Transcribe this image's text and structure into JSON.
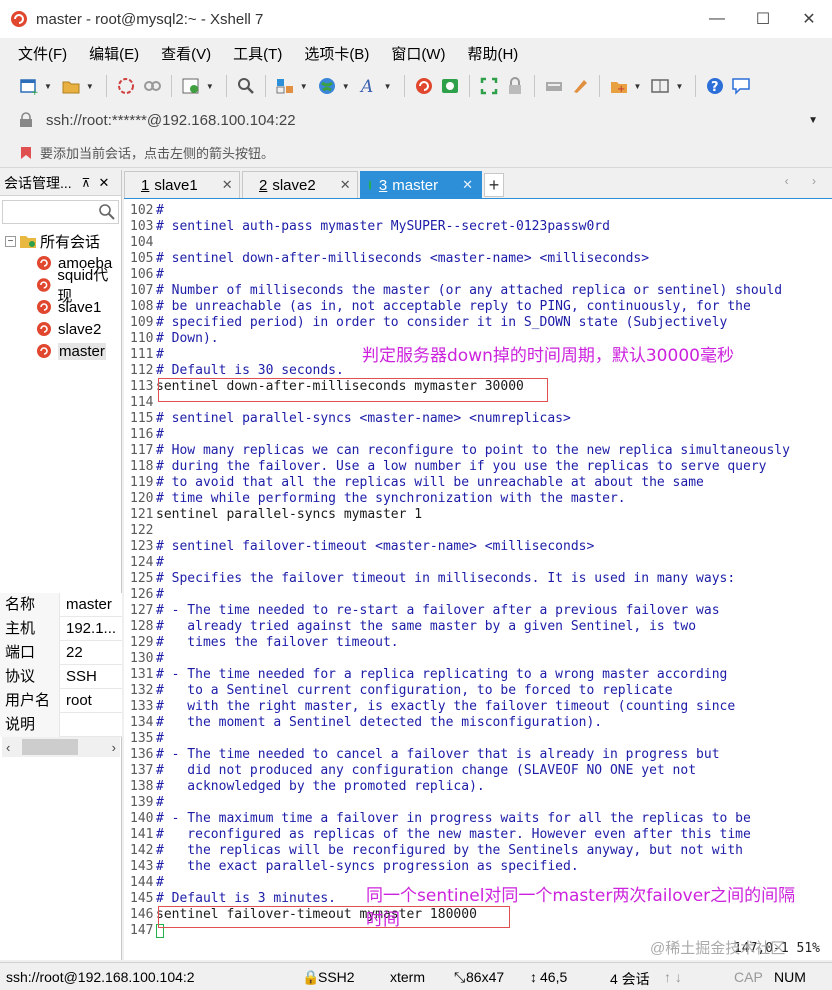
{
  "window": {
    "title": "master - root@mysql2:~ - Xshell 7",
    "minimize": "—",
    "maximize": "☐",
    "close": "✕"
  },
  "menu": [
    "文件(F)",
    "编辑(E)",
    "查看(V)",
    "工具(T)",
    "选项卡(B)",
    "窗口(W)",
    "帮助(H)"
  ],
  "address": {
    "value": "ssh://root:******@192.168.100.104:22"
  },
  "hint": "要添加当前会话，点击左侧的箭头按钮。",
  "sidebar": {
    "title": "会话管理...",
    "pin": "⊼",
    "close": "✕",
    "root_label": "所有会话",
    "expander": "−",
    "items": [
      {
        "label": "amoeba"
      },
      {
        "label": "squid代现"
      },
      {
        "label": "slave1"
      },
      {
        "label": "slave2"
      },
      {
        "label": "master"
      }
    ],
    "scroll_left": "‹",
    "scroll_right": "›"
  },
  "properties": [
    {
      "key": "名称",
      "value": "master"
    },
    {
      "key": "主机",
      "value": "192.1..."
    },
    {
      "key": "端口",
      "value": "22"
    },
    {
      "key": "协议",
      "value": "SSH"
    },
    {
      "key": "用户名",
      "value": "root"
    },
    {
      "key": "说明",
      "value": ""
    }
  ],
  "tabs": [
    {
      "num": "1",
      "label": "slave1",
      "close": "✕"
    },
    {
      "num": "2",
      "label": "slave2",
      "close": "✕"
    },
    {
      "num": "3",
      "label": "master",
      "close": "✕"
    }
  ],
  "tab_add": "+",
  "tab_nav": "‹ ›",
  "terminal": {
    "lines": [
      {
        "n": "102",
        "t": "#",
        "plain": false
      },
      {
        "n": "103",
        "t": "# sentinel auth-pass mymaster MySUPER--secret-0123passw0rd",
        "plain": false
      },
      {
        "n": "104",
        "t": "",
        "plain": false
      },
      {
        "n": "105",
        "t": "# sentinel down-after-milliseconds <master-name> <milliseconds>",
        "plain": false
      },
      {
        "n": "106",
        "t": "#",
        "plain": false
      },
      {
        "n": "107",
        "t": "# Number of milliseconds the master (or any attached replica or sentinel) should",
        "plain": false
      },
      {
        "n": "108",
        "t": "# be unreachable (as in, not acceptable reply to PING, continuously, for the",
        "plain": false
      },
      {
        "n": "109",
        "t": "# specified period) in order to consider it in S_DOWN state (Subjectively",
        "plain": false
      },
      {
        "n": "110",
        "t": "# Down).",
        "plain": false
      },
      {
        "n": "111",
        "t": "#",
        "plain": false
      },
      {
        "n": "112",
        "t": "# Default is 30 seconds.",
        "plain": false
      },
      {
        "n": "113",
        "t": "sentinel down-after-milliseconds mymaster 30000",
        "plain": true
      },
      {
        "n": "114",
        "t": "",
        "plain": false
      },
      {
        "n": "115",
        "t": "# sentinel parallel-syncs <master-name> <numreplicas>",
        "plain": false
      },
      {
        "n": "116",
        "t": "#",
        "plain": false
      },
      {
        "n": "117",
        "t": "# How many replicas we can reconfigure to point to the new replica simultaneously",
        "plain": false
      },
      {
        "n": "118",
        "t": "# during the failover. Use a low number if you use the replicas to serve query",
        "plain": false
      },
      {
        "n": "119",
        "t": "# to avoid that all the replicas will be unreachable at about the same",
        "plain": false
      },
      {
        "n": "120",
        "t": "# time while performing the synchronization with the master.",
        "plain": false
      },
      {
        "n": "121",
        "t": "sentinel parallel-syncs mymaster 1",
        "plain": true
      },
      {
        "n": "122",
        "t": "",
        "plain": false
      },
      {
        "n": "123",
        "t": "# sentinel failover-timeout <master-name> <milliseconds>",
        "plain": false
      },
      {
        "n": "124",
        "t": "#",
        "plain": false
      },
      {
        "n": "125",
        "t": "# Specifies the failover timeout in milliseconds. It is used in many ways:",
        "plain": false
      },
      {
        "n": "126",
        "t": "#",
        "plain": false
      },
      {
        "n": "127",
        "t": "# - The time needed to re-start a failover after a previous failover was",
        "plain": false
      },
      {
        "n": "128",
        "t": "#   already tried against the same master by a given Sentinel, is two",
        "plain": false
      },
      {
        "n": "129",
        "t": "#   times the failover timeout.",
        "plain": false
      },
      {
        "n": "130",
        "t": "#",
        "plain": false
      },
      {
        "n": "131",
        "t": "# - The time needed for a replica replicating to a wrong master according",
        "plain": false
      },
      {
        "n": "132",
        "t": "#   to a Sentinel current configuration, to be forced to replicate",
        "plain": false
      },
      {
        "n": "133",
        "t": "#   with the right master, is exactly the failover timeout (counting since",
        "plain": false
      },
      {
        "n": "134",
        "t": "#   the moment a Sentinel detected the misconfiguration).",
        "plain": false
      },
      {
        "n": "135",
        "t": "#",
        "plain": false
      },
      {
        "n": "136",
        "t": "# - The time needed to cancel a failover that is already in progress but",
        "plain": false
      },
      {
        "n": "137",
        "t": "#   did not produced any configuration change (SLAVEOF NO ONE yet not",
        "plain": false
      },
      {
        "n": "138",
        "t": "#   acknowledged by the promoted replica).",
        "plain": false
      },
      {
        "n": "139",
        "t": "#",
        "plain": false
      },
      {
        "n": "140",
        "t": "# - The maximum time a failover in progress waits for all the replicas to be",
        "plain": false
      },
      {
        "n": "141",
        "t": "#   reconfigured as replicas of the new master. However even after this time",
        "plain": false
      },
      {
        "n": "142",
        "t": "#   the replicas will be reconfigured by the Sentinels anyway, but not with",
        "plain": false
      },
      {
        "n": "143",
        "t": "#   the exact parallel-syncs progression as specified.",
        "plain": false
      },
      {
        "n": "144",
        "t": "#",
        "plain": false
      },
      {
        "n": "145",
        "t": "# Default is 3 minutes.",
        "plain": false
      },
      {
        "n": "146",
        "t": "sentinel failover-timeout mymaster 180000",
        "plain": true
      },
      {
        "n": "147",
        "t": "",
        "plain": false
      }
    ],
    "annotation1": "判定服务器down掉的时间周期，默认30000毫秒",
    "annotation2_line1": "同一个sentinel对同一个master两次failover之间的间隔",
    "annotation2_line2": "时间",
    "position": "147,0-1        51%",
    "watermark": "@稀土掘金技术社区"
  },
  "status": {
    "connection": "ssh://root@192.168.100.104:2",
    "protocol": "SSH2",
    "term": "xterm",
    "size": "86x47",
    "cursor_pos": "46,5",
    "sessions": "4 会话",
    "cap": "CAP",
    "num": "NUM"
  },
  "colors": {
    "accent": "#2c8fd8",
    "annotation": "#cc22dd",
    "highlight_box": "#e05050",
    "comment_text": "#1c1ca8"
  }
}
